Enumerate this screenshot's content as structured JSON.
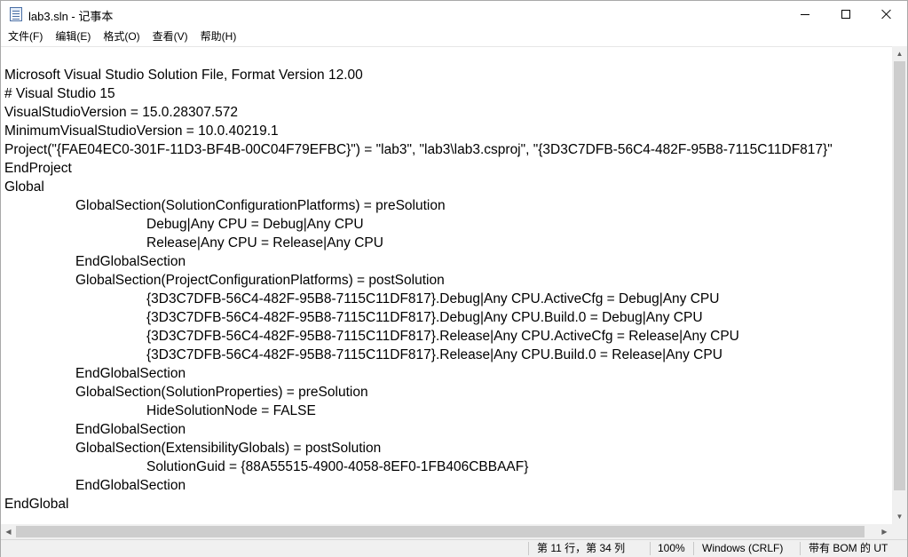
{
  "window": {
    "title": "lab3.sln - 记事本"
  },
  "menu": [
    {
      "label": "文件(F)"
    },
    {
      "label": "编辑(E)"
    },
    {
      "label": "格式(O)"
    },
    {
      "label": "查看(V)"
    },
    {
      "label": "帮助(H)"
    }
  ],
  "editor": {
    "lines": [
      {
        "text": "Microsoft Visual Studio Solution File, Format Version 12.00",
        "indent": 0
      },
      {
        "text": "# Visual Studio 15",
        "indent": 0
      },
      {
        "text": "VisualStudioVersion = 15.0.28307.572",
        "indent": 0
      },
      {
        "text": "MinimumVisualStudioVersion = 10.0.40219.1",
        "indent": 0
      },
      {
        "text": "Project(\"{FAE04EC0-301F-11D3-BF4B-00C04F79EFBC}\") = \"lab3\", \"lab3\\lab3.csproj\", \"{3D3C7DFB-56C4-482F-95B8-7115C11DF817}\"",
        "indent": 0
      },
      {
        "text": "EndProject",
        "indent": 0
      },
      {
        "text": "Global",
        "indent": 0
      },
      {
        "text": "GlobalSection(SolutionConfigurationPlatforms) = preSolution",
        "indent": 1
      },
      {
        "text": "Debug|Any CPU = Debug|Any CPU",
        "indent": 2
      },
      {
        "text": "Release|Any CPU = Release|Any CPU",
        "indent": 2
      },
      {
        "text": "EndGlobalSection",
        "indent": 1
      },
      {
        "text": "GlobalSection(ProjectConfigurationPlatforms) = postSolution",
        "indent": 1
      },
      {
        "text": "{3D3C7DFB-56C4-482F-95B8-7115C11DF817}.Debug|Any CPU.ActiveCfg = Debug|Any CPU",
        "indent": 2
      },
      {
        "text": "{3D3C7DFB-56C4-482F-95B8-7115C11DF817}.Debug|Any CPU.Build.0 = Debug|Any CPU",
        "indent": 2
      },
      {
        "text": "{3D3C7DFB-56C4-482F-95B8-7115C11DF817}.Release|Any CPU.ActiveCfg = Release|Any CPU",
        "indent": 2
      },
      {
        "text": "{3D3C7DFB-56C4-482F-95B8-7115C11DF817}.Release|Any CPU.Build.0 = Release|Any CPU",
        "indent": 2
      },
      {
        "text": "EndGlobalSection",
        "indent": 1
      },
      {
        "text": "GlobalSection(SolutionProperties) = preSolution",
        "indent": 1
      },
      {
        "text": "HideSolutionNode = FALSE",
        "indent": 2
      },
      {
        "text": "EndGlobalSection",
        "indent": 1
      },
      {
        "text": "GlobalSection(ExtensibilityGlobals) = postSolution",
        "indent": 1
      },
      {
        "text": "SolutionGuid = {88A55515-4900-4058-8EF0-1FB406CBBAAF}",
        "indent": 2
      },
      {
        "text": "EndGlobalSection",
        "indent": 1
      },
      {
        "text": "EndGlobal",
        "indent": 0
      }
    ]
  },
  "status": {
    "position": "第 11 行，第 34 列",
    "zoom": "100%",
    "line_ending": "Windows (CRLF)",
    "encoding": "带有 BOM 的 UT"
  },
  "icons": {
    "app": "notepad-icon",
    "minimize": "minimize-icon",
    "maximize": "maximize-icon",
    "close": "close-icon"
  }
}
